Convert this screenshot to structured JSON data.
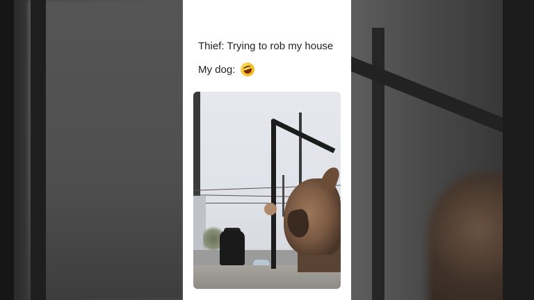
{
  "caption": {
    "line1": "Thief:  Trying to rob my house",
    "line2_label": "My dog:",
    "emoji": "🤣"
  }
}
